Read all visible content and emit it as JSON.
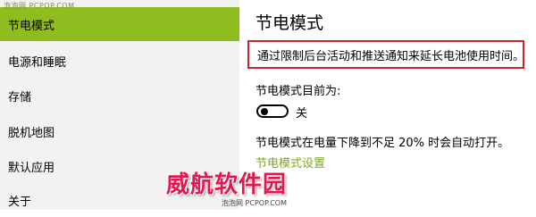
{
  "watermark_top": "泡泡网 PCPOP.COM",
  "sidebar": {
    "items": [
      {
        "label": "节电模式",
        "selected": true
      },
      {
        "label": "电源和睡眠",
        "selected": false
      },
      {
        "label": "存储",
        "selected": false
      },
      {
        "label": "脱机地图",
        "selected": false
      },
      {
        "label": "默认应用",
        "selected": false
      },
      {
        "label": "关于",
        "selected": false
      }
    ]
  },
  "main": {
    "title": "节电模式",
    "description": "通过限制后台活动和推送通知来延长电池使用时间。",
    "status_label": "节电模式目前为:",
    "toggle_state": "关",
    "auto_text": "节电模式在电量下降到不足 20% 时会自动打开。",
    "settings_link": "节电模式设置"
  },
  "brand_logo": "威航软件园",
  "watermark_bottom": "泡泡网 PCPOP.COM",
  "colors": {
    "accent": "#8fbc1f",
    "link": "#7aa71f",
    "highlight_border": "#c9262c",
    "logo": "#e01a4f"
  }
}
